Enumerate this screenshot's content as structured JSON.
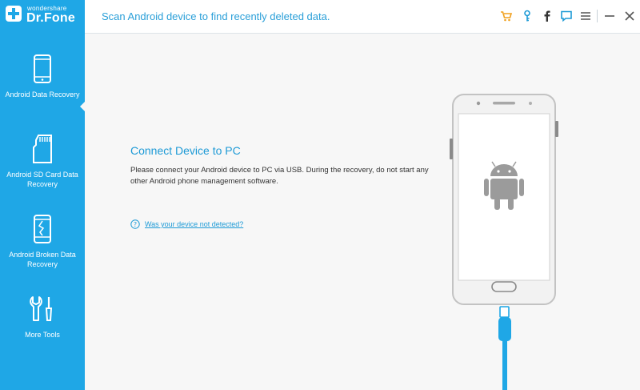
{
  "app": {
    "logo_small": "wondershare",
    "logo_big": "Dr.Fone",
    "brand_color": "#1fa7e6"
  },
  "header": {
    "title": "Scan Android device to find recently deleted data.",
    "icons": [
      "cart-icon",
      "key-icon",
      "facebook-icon",
      "feedback-icon",
      "menu-icon",
      "minimize-icon",
      "close-icon"
    ]
  },
  "sidebar": {
    "items": [
      {
        "label": "Android Data Recovery",
        "icon": "phone-icon",
        "active": true
      },
      {
        "label": "Android SD Card Data Recovery",
        "icon": "sd-card-icon",
        "active": false
      },
      {
        "label": "Android Broken Data Recovery",
        "icon": "broken-phone-icon",
        "active": false
      },
      {
        "label": "More Tools",
        "icon": "tools-icon",
        "active": false
      }
    ]
  },
  "main": {
    "title": "Connect Device to PC",
    "description": "Please connect your Android device to PC via USB. During the recovery, do not start any other Android phone management software.",
    "help_link": "Was your device not detected?",
    "accent_color": "#1d9ad6"
  }
}
